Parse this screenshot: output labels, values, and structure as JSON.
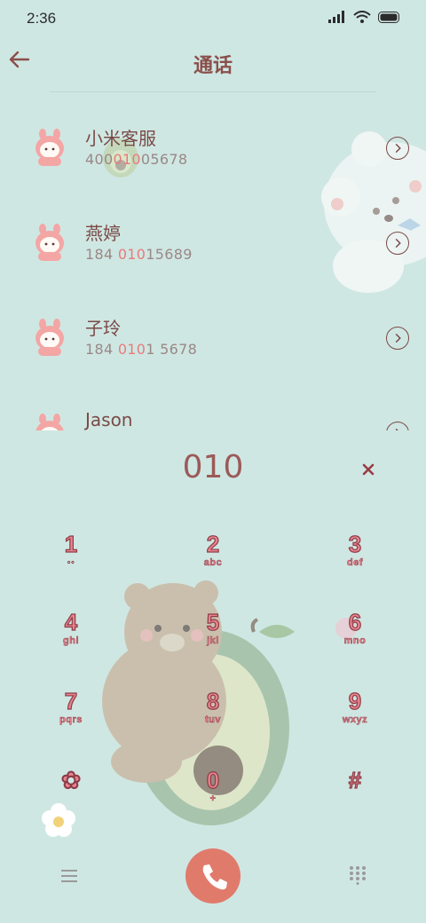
{
  "status": {
    "time": "2:36"
  },
  "header": {
    "title": "通话"
  },
  "contacts": [
    {
      "name": "小米客服",
      "num_pre": "400",
      "num_hl": "010",
      "num_post": "05678"
    },
    {
      "name": "燕婷",
      "num_pre": "184 ",
      "num_hl": "010",
      "num_post": "15689"
    },
    {
      "name": "子玲",
      "num_pre": "184 ",
      "num_hl": "010",
      "num_post": "1 5678"
    },
    {
      "name": "Jason",
      "num_pre": "",
      "num_hl": "",
      "num_post": ""
    }
  ],
  "dialer": {
    "number": "010"
  },
  "keypad": [
    {
      "digit": "1",
      "letters": "◦◦"
    },
    {
      "digit": "2",
      "letters": "abc"
    },
    {
      "digit": "3",
      "letters": "def"
    },
    {
      "digit": "4",
      "letters": "ghi"
    },
    {
      "digit": "5",
      "letters": "jkl"
    },
    {
      "digit": "6",
      "letters": "mno"
    },
    {
      "digit": "7",
      "letters": "pqrs"
    },
    {
      "digit": "8",
      "letters": "tuv"
    },
    {
      "digit": "9",
      "letters": "wxyz"
    },
    {
      "digit": "✿",
      "letters": ""
    },
    {
      "digit": "0",
      "letters": "+"
    },
    {
      "digit": "#",
      "letters": ""
    }
  ],
  "colors": {
    "background": "#cfe7e3",
    "accent": "#e07b6c",
    "text": "#7a4a47",
    "highlight": "#e87b7b"
  }
}
